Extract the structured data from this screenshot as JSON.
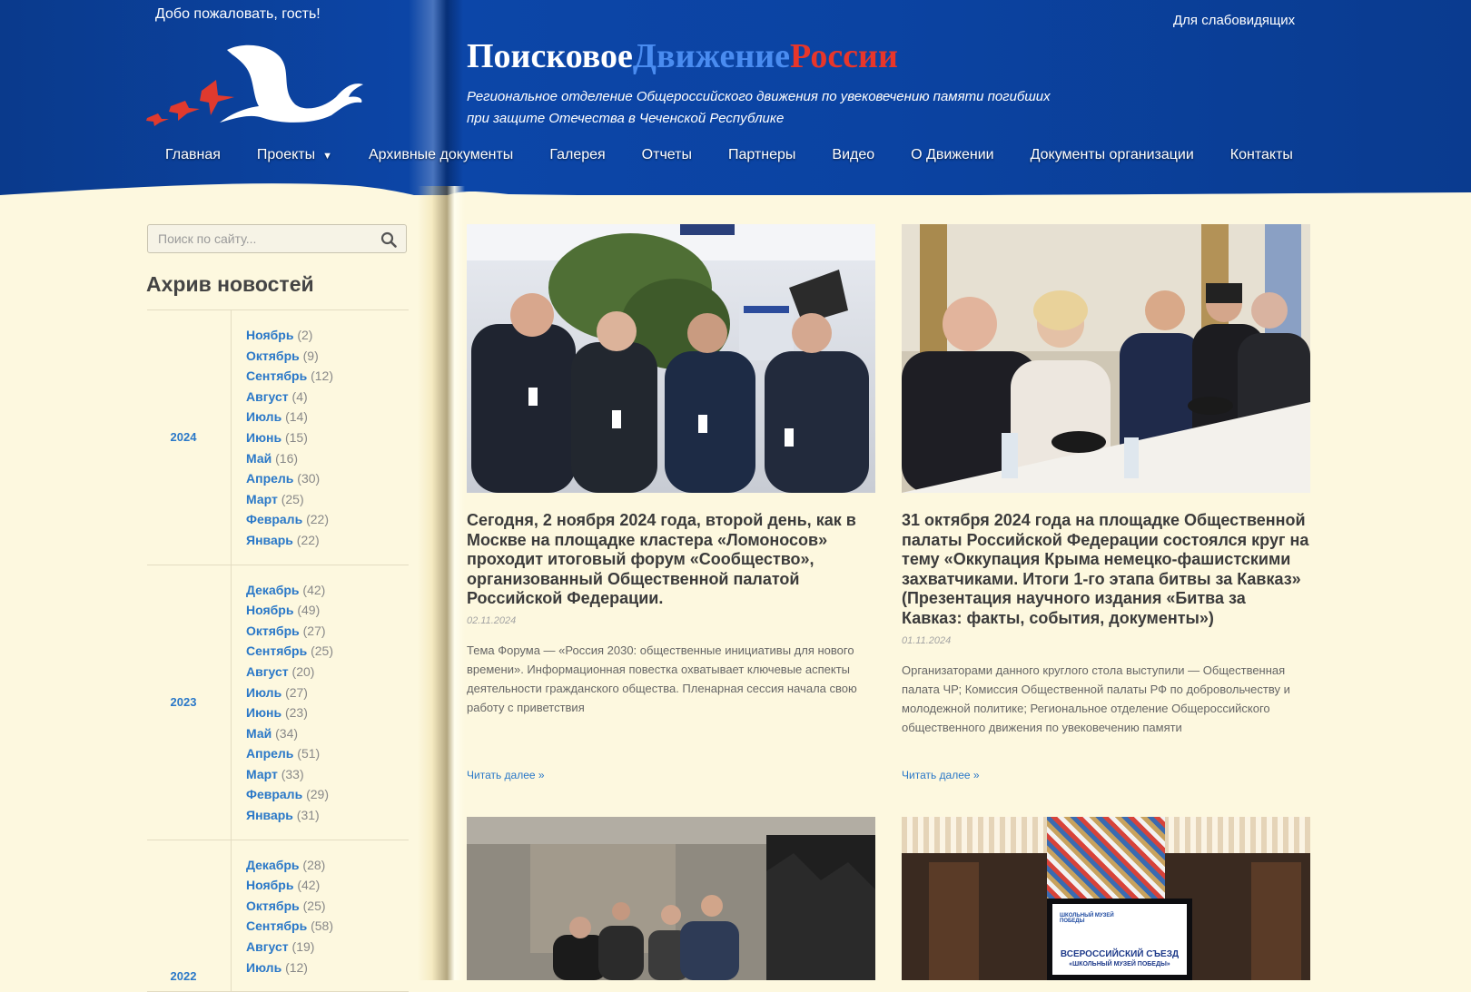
{
  "header": {
    "welcome": "Добо пожаловать, гость!",
    "accessibility_link": "Для слабовидящих",
    "title_part1": "Поисковое",
    "title_part2": "Движение",
    "title_part3": "России",
    "subtitle_line1": "Региональное отделение Общероссийского движения по увековечению памяти погибших",
    "subtitle_line2": "при защите Отечества в Чеченской Республике"
  },
  "nav": [
    {
      "label": "Главная"
    },
    {
      "label": "Проекты",
      "has_dropdown": true
    },
    {
      "label": "Архивные документы"
    },
    {
      "label": "Галерея"
    },
    {
      "label": "Отчеты"
    },
    {
      "label": "Партнеры"
    },
    {
      "label": "Видео"
    },
    {
      "label": "О Движении"
    },
    {
      "label": "Документы организации"
    },
    {
      "label": "Контакты"
    }
  ],
  "sidebar": {
    "search_placeholder": "Поиск по сайту...",
    "archive_title": "Ахрив новостей",
    "years": [
      {
        "year": "2024",
        "months": [
          {
            "name": "Ноябрь",
            "count": "(2)"
          },
          {
            "name": "Октябрь",
            "count": "(9)"
          },
          {
            "name": "Сентябрь",
            "count": "(12)"
          },
          {
            "name": "Август",
            "count": "(4)"
          },
          {
            "name": "Июль",
            "count": "(14)"
          },
          {
            "name": "Июнь",
            "count": "(15)"
          },
          {
            "name": "Май",
            "count": "(16)"
          },
          {
            "name": "Апрель",
            "count": "(30)"
          },
          {
            "name": "Март",
            "count": "(25)"
          },
          {
            "name": "Февраль",
            "count": "(22)"
          },
          {
            "name": "Январь",
            "count": "(22)"
          }
        ]
      },
      {
        "year": "2023",
        "months": [
          {
            "name": "Декабрь",
            "count": "(42)"
          },
          {
            "name": "Ноябрь",
            "count": "(49)"
          },
          {
            "name": "Октябрь",
            "count": "(27)"
          },
          {
            "name": "Сентябрь",
            "count": "(25)"
          },
          {
            "name": "Август",
            "count": "(20)"
          },
          {
            "name": "Июль",
            "count": "(27)"
          },
          {
            "name": "Июнь",
            "count": "(23)"
          },
          {
            "name": "Май",
            "count": "(34)"
          },
          {
            "name": "Апрель",
            "count": "(51)"
          },
          {
            "name": "Март",
            "count": "(33)"
          },
          {
            "name": "Февраль",
            "count": "(29)"
          },
          {
            "name": "Январь",
            "count": "(31)"
          }
        ]
      },
      {
        "year": "2022",
        "months": [
          {
            "name": "Декабрь",
            "count": "(28)"
          },
          {
            "name": "Ноябрь",
            "count": "(42)"
          },
          {
            "name": "Октябрь",
            "count": "(25)"
          },
          {
            "name": "Сентябрь",
            "count": "(58)"
          },
          {
            "name": "Август",
            "count": "(19)"
          },
          {
            "name": "Июль",
            "count": "(12)"
          }
        ]
      }
    ]
  },
  "posts": [
    {
      "title": "Сегодня, 2 ноября 2024 года, второй день, как в Москве на площадке кластера «Ломоносов» проходит итоговый форум «Сообщество», организованный Общественной палатой Российской Федерации.",
      "date": "02.11.2024",
      "excerpt": "Тема Форума — «Россия 2030: общественные инициативы для нового времени». Информационная повестка охватывает ключевые аспекты деятельности гражданского общества. Пленарная сессия начала свою работу с приветствия",
      "read_more": "Читать далее »"
    },
    {
      "title": "31 октября 2024 года на площадке Общественной палаты Российской Федерации состоялся круг на тему «Оккупация Крыма немецко-фашистскими захватчиками. Итоги 1-го этапа битвы за Кавказ» (Презентация научного издания «Битва за Кавказ: факты, события, документы»)",
      "date": "01.11.2024",
      "excerpt": "Организаторами данного круглого стола выступили — Общественная палата ЧР; Комиссия Общественной палаты РФ по добровольчеству и молодежной политике; Региональное отделение Общероссийского общественного движения по увековечению памяти",
      "read_more": "Читать далее »"
    }
  ],
  "photo4": {
    "banner_line1": "ВСЕРОССИЙСКИЙ СЪЕЗД",
    "banner_line2": "«ШКОЛЬНЫЙ МУЗЕЙ ПОБЕДЫ»",
    "banner_badge": "ШКОЛЬНЫЙ МУЗЕЙ ПОБЕДЫ"
  },
  "colors": {
    "header_blue": "#0b43a2",
    "page_background": "#fdf8df",
    "link_blue": "#2a78c8",
    "title_white": "#ffffff",
    "title_blue": "#4a8cf0",
    "title_red": "#e8362a"
  }
}
